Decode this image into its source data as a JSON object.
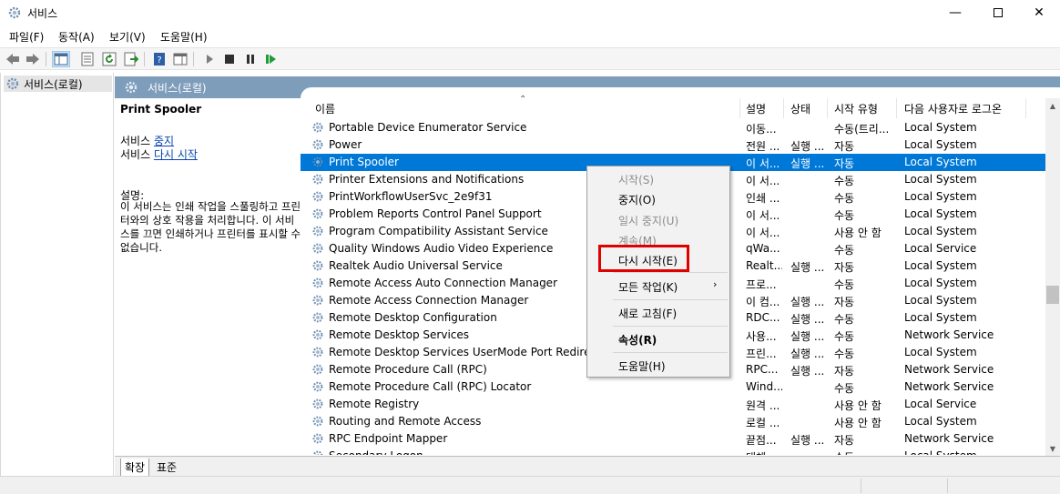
{
  "window": {
    "title": "서비스"
  },
  "menu": [
    "파일(F)",
    "동작(A)",
    "보기(V)",
    "도움말(H)"
  ],
  "tree": {
    "root_label": "서비스(로컬)"
  },
  "content_header": {
    "title": "서비스(로컬)"
  },
  "detail": {
    "service_name": "Print Spooler",
    "line1_prefix": "서비스 ",
    "line1_link": "중지",
    "line2_prefix": "서비스 ",
    "line2_link": "다시 시작",
    "desc_label": "설명:",
    "desc_text": "이 서비스는 인쇄 작업을 스풀링하고 프린터와의 상호 작용을 처리합니다. 이 서비스를 끄면 인쇄하거나 프린터를 표시할 수 없습니다."
  },
  "columns": {
    "name": "이름",
    "desc": "설명",
    "status": "상태",
    "startup": "시작 유형",
    "logon": "다음 사용자로 로그온"
  },
  "services": [
    {
      "name": "Portable Device Enumerator Service",
      "desc": "이동...",
      "status": "",
      "startup": "수동(트리...",
      "logon": "Local System"
    },
    {
      "name": "Power",
      "desc": "전원 ...",
      "status": "실행 ...",
      "startup": "자동",
      "logon": "Local System"
    },
    {
      "name": "Print Spooler",
      "desc": "이 서...",
      "status": "실행 ...",
      "startup": "자동",
      "logon": "Local System"
    },
    {
      "name": "Printer Extensions and Notifications",
      "desc": "이 서...",
      "status": "",
      "startup": "수동",
      "logon": "Local System"
    },
    {
      "name": "PrintWorkflowUserSvc_2e9f31",
      "desc": "인쇄 ...",
      "status": "",
      "startup": "수동",
      "logon": "Local System"
    },
    {
      "name": "Problem Reports Control Panel Support",
      "desc": "이 서...",
      "status": "",
      "startup": "수동",
      "logon": "Local System"
    },
    {
      "name": "Program Compatibility Assistant Service",
      "desc": "이 서...",
      "status": "",
      "startup": "사용 안 함",
      "logon": "Local System"
    },
    {
      "name": "Quality Windows Audio Video Experience",
      "desc": "qWa...",
      "status": "",
      "startup": "수동",
      "logon": "Local Service"
    },
    {
      "name": "Realtek Audio Universal Service",
      "desc": "Realt...",
      "status": "실행 ...",
      "startup": "자동",
      "logon": "Local System"
    },
    {
      "name": "Remote Access Auto Connection Manager",
      "desc": "프로...",
      "status": "",
      "startup": "수동",
      "logon": "Local System"
    },
    {
      "name": "Remote Access Connection Manager",
      "desc": "이 컴...",
      "status": "실행 ...",
      "startup": "자동",
      "logon": "Local System"
    },
    {
      "name": "Remote Desktop Configuration",
      "desc": "RDC...",
      "status": "실행 ...",
      "startup": "수동",
      "logon": "Local System"
    },
    {
      "name": "Remote Desktop Services",
      "desc": "사용...",
      "status": "실행 ...",
      "startup": "수동",
      "logon": "Network Service"
    },
    {
      "name": "Remote Desktop Services UserMode Port Redirector",
      "desc": "프린...",
      "status": "실행 ...",
      "startup": "수동",
      "logon": "Local System"
    },
    {
      "name": "Remote Procedure Call (RPC)",
      "desc": "RPC...",
      "status": "실행 ...",
      "startup": "자동",
      "logon": "Network Service"
    },
    {
      "name": "Remote Procedure Call (RPC) Locator",
      "desc": "Wind...",
      "status": "",
      "startup": "수동",
      "logon": "Network Service"
    },
    {
      "name": "Remote Registry",
      "desc": "원격 ...",
      "status": "",
      "startup": "사용 안 함",
      "logon": "Local Service"
    },
    {
      "name": "Routing and Remote Access",
      "desc": "로컬 ...",
      "status": "",
      "startup": "사용 안 함",
      "logon": "Local System"
    },
    {
      "name": "RPC Endpoint Mapper",
      "desc": "끝점...",
      "status": "실행 ...",
      "startup": "자동",
      "logon": "Network Service"
    },
    {
      "name": "Secondary Logon",
      "desc": "대체 ...",
      "status": "",
      "startup": "수동",
      "logon": "Local System"
    }
  ],
  "selected_service": "Print Spooler",
  "context_menu": {
    "start": "시작(S)",
    "stop": "중지(O)",
    "pause": "일시 중지(U)",
    "resume": "계속(M)",
    "restart": "다시 시작(E)",
    "all_tasks": "모든 작업(K)",
    "refresh": "새로 고침(F)",
    "properties": "속성(R)",
    "help": "도움말(H)"
  },
  "tabs": {
    "extended": "확장",
    "standard": "표준"
  },
  "colors": {
    "selection": "#0078d7",
    "header": "#7e9dbb",
    "highlight": "#e00000",
    "link": "#0645ad"
  }
}
